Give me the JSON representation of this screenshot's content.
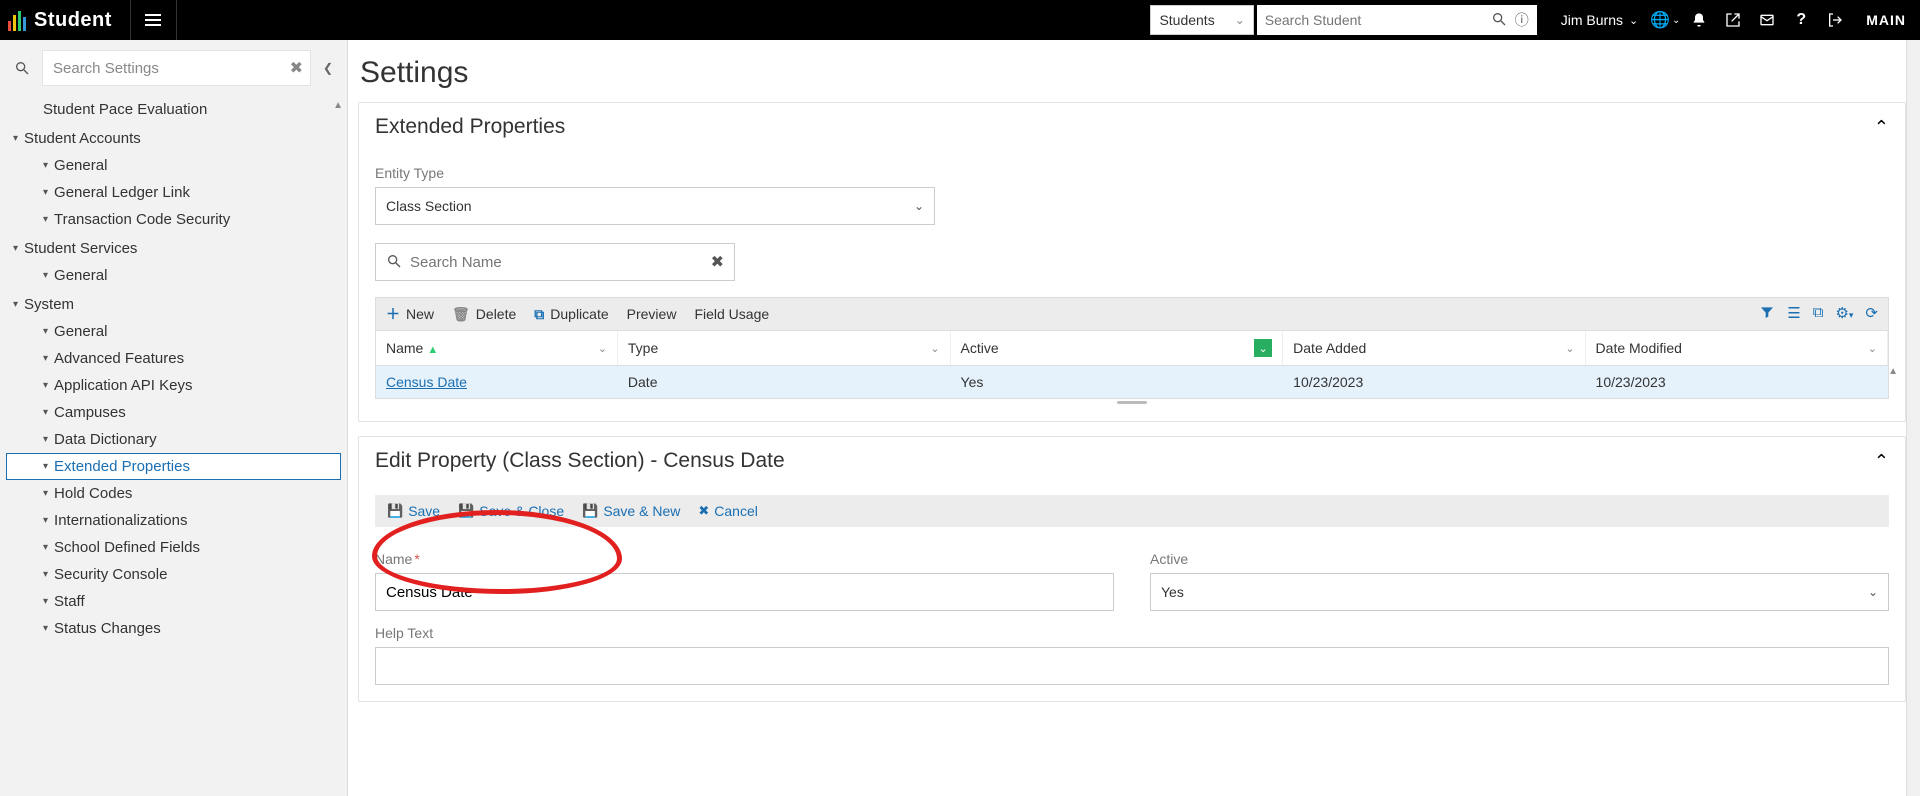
{
  "topbar": {
    "app_name": "Student",
    "scope_label": "Students",
    "search_placeholder": "Search Student",
    "user_name": "Jim Burns",
    "env_label": "MAIN"
  },
  "sidebar": {
    "search_placeholder": "Search Settings",
    "items": [
      {
        "label": "Student Pace Evaluation",
        "type": "leaf"
      },
      {
        "label": "Student Accounts",
        "type": "group",
        "children": [
          {
            "label": "General"
          },
          {
            "label": "General Ledger Link"
          },
          {
            "label": "Transaction Code Security"
          }
        ]
      },
      {
        "label": "Student Services",
        "type": "group",
        "children": [
          {
            "label": "General"
          }
        ]
      },
      {
        "label": "System",
        "type": "group",
        "children": [
          {
            "label": "General"
          },
          {
            "label": "Advanced Features"
          },
          {
            "label": "Application API Keys"
          },
          {
            "label": "Campuses"
          },
          {
            "label": "Data Dictionary"
          },
          {
            "label": "Extended Properties",
            "selected": true
          },
          {
            "label": "Hold Codes"
          },
          {
            "label": "Internationalizations"
          },
          {
            "label": "School Defined Fields"
          },
          {
            "label": "Security Console"
          },
          {
            "label": "Staff"
          },
          {
            "label": "Status Changes"
          }
        ]
      }
    ]
  },
  "page": {
    "title": "Settings"
  },
  "extended": {
    "panel_title": "Extended Properties",
    "entity_type_label": "Entity Type",
    "entity_type_value": "Class Section",
    "search_placeholder": "Search Name",
    "toolbar": {
      "new": "New",
      "delete": "Delete",
      "duplicate": "Duplicate",
      "preview": "Preview",
      "field_usage": "Field Usage"
    },
    "columns": {
      "name": "Name",
      "type": "Type",
      "active": "Active",
      "date_added": "Date Added",
      "date_modified": "Date Modified"
    },
    "rows": [
      {
        "name": "Census Date",
        "type": "Date",
        "active": "Yes",
        "added": "10/23/2023",
        "modified": "10/23/2023"
      }
    ]
  },
  "edit": {
    "panel_title": "Edit Property (Class Section) - Census Date",
    "toolbar": {
      "save": "Save",
      "save_close": "Save & Close",
      "save_new": "Save & New",
      "cancel": "Cancel"
    },
    "name_label": "Name",
    "name_value": "Census Date",
    "active_label": "Active",
    "active_value": "Yes",
    "help_label": "Help Text"
  }
}
